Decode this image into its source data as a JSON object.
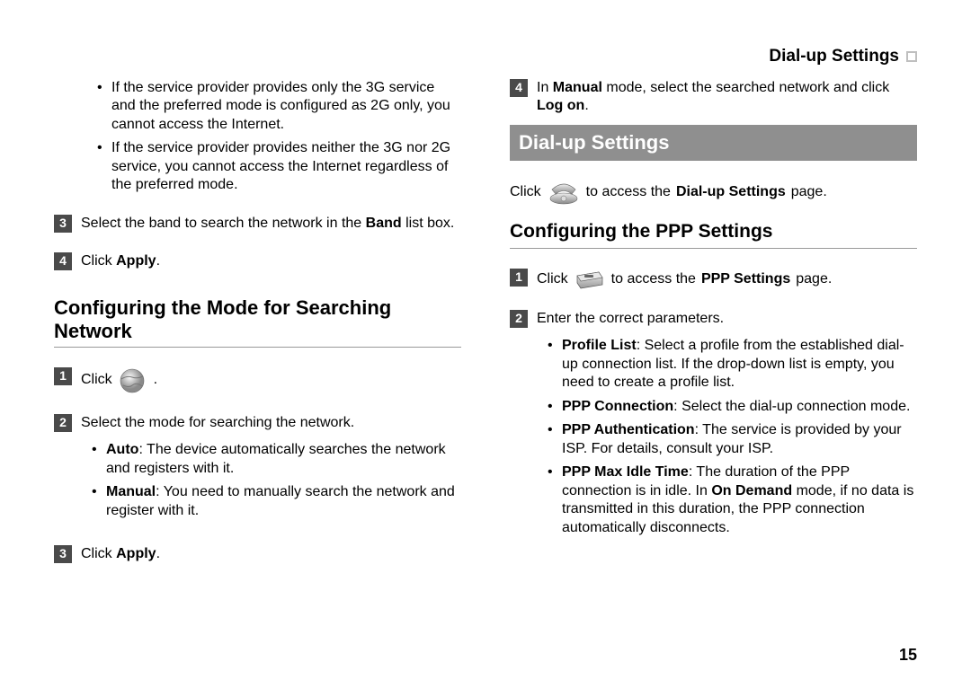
{
  "header": {
    "title": "Dial-up Settings"
  },
  "left": {
    "notes": [
      "If the service provider provides only the 3G service and the preferred mode is configured as 2G only, you cannot access the Internet.",
      "If the service provider provides neither the 3G nor 2G service, you cannot access the Internet regardless of the preferred mode."
    ],
    "step3_num": "3",
    "step3_pre": "Select the band to search the network in the ",
    "step3_bold": "Band",
    "step3_post": " list box.",
    "step4_num": "4",
    "step4_pre": "Click ",
    "step4_bold": "Apply",
    "step4_post": ".",
    "section_title": "Configuring the Mode for Searching Network",
    "s1_num": "1",
    "s1_pre": "Click",
    "s1_post": ".",
    "s2_num": "2",
    "s2_text": "Select the mode for searching the network.",
    "s2_b1_bold": "Auto",
    "s2_b1_rest": ": The device automatically searches the network and registers with it.",
    "s2_b2_bold": "Manual",
    "s2_b2_rest": ": You need to manually search the network and register with it.",
    "s3_num": "3",
    "s3_pre": "Click ",
    "s3_bold": "Apply",
    "s3_post": "."
  },
  "right": {
    "top_num": "4",
    "top_pre": "In ",
    "top_bold1": "Manual",
    "top_mid": " mode, select the searched network and click ",
    "top_bold2": "Log on",
    "top_post": ".",
    "bar": "Dial-up Settings",
    "intro_pre": "Click ",
    "intro_mid": " to access the ",
    "intro_bold": "Dial-up Settings",
    "intro_post": " page.",
    "subsection": "Configuring the PPP Settings",
    "p1_num": "1",
    "p1_pre": "Click",
    "p1_mid": " to access the ",
    "p1_bold": "PPP Settings",
    "p1_post": " page.",
    "p2_num": "2",
    "p2_text": "Enter the correct parameters.",
    "b1_bold": "Profile List",
    "b1_rest": ": Select a profile from the established dial-up connection list. If the drop-down list is empty, you need to create a profile list.",
    "b2_bold": "PPP Connection",
    "b2_rest": ": Select the dial-up connection mode.",
    "b3_bold": "PPP Authentication",
    "b3_rest": ": The service is provided by your ISP. For details, consult your ISP.",
    "b4_bold": "PPP Max Idle Time",
    "b4_mid1": ": The duration of the PPP connection is in idle. In ",
    "b4_bold2": "On Demand",
    "b4_rest": " mode, if no data is transmitted in this duration, the PPP connection automatically disconnects."
  },
  "page_number": "15"
}
